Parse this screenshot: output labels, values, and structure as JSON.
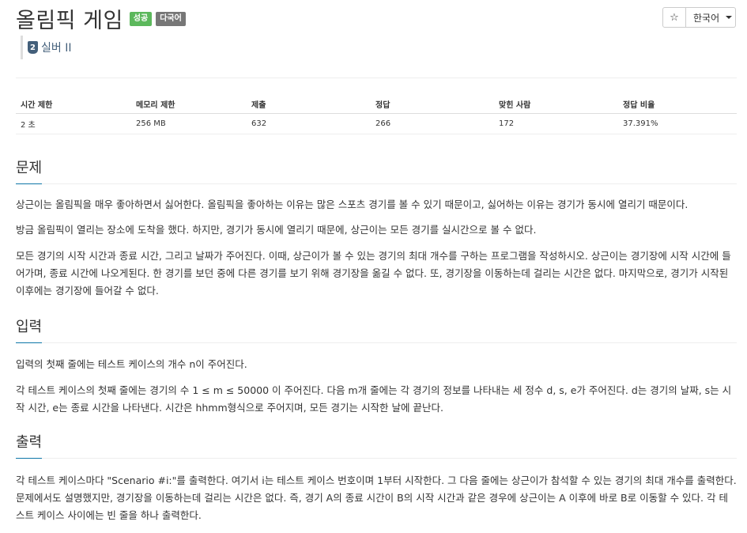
{
  "problem": {
    "title": "올림픽 게임",
    "labels": {
      "status": "성공",
      "lang": "다국어"
    },
    "tier": {
      "badge": "2",
      "text": "실버 II"
    }
  },
  "toolbar": {
    "star": "☆",
    "language": "한국어"
  },
  "info_table": {
    "headers": [
      "시간 제한",
      "메모리 제한",
      "제출",
      "정답",
      "맞힌 사람",
      "정답 비율"
    ],
    "values": [
      "2 초",
      "256 MB",
      "632",
      "266",
      "172",
      "37.391%"
    ]
  },
  "sections": {
    "description": {
      "title": "문제",
      "paragraphs": [
        "상근이는 올림픽을 매우 좋아하면서 싫어한다. 올림픽을 좋아하는 이유는 많은 스포츠 경기를 볼 수 있기 때문이고, 싫어하는 이유는 경기가 동시에 열리기 때문이다.",
        "방금 올림픽이 열리는 장소에 도착을 했다. 하지만, 경기가 동시에 열리기 때문에, 상근이는 모든 경기를 실시간으로 볼 수 없다.",
        "모든 경기의 시작 시간과 종료 시간, 그리고 날짜가 주어진다. 이때, 상근이가 볼 수 있는 경기의 최대 개수를 구하는 프로그램을 작성하시오. 상근이는 경기장에 시작 시간에 들어가며, 종료 시간에 나오게된다. 한 경기를 보던 중에 다른 경기를 보기 위해 경기장을 옮길 수 없다. 또, 경기장을 이동하는데 걸리는 시간은 없다. 마지막으로, 경기가 시작된 이후에는 경기장에 들어갈 수 없다."
      ]
    },
    "input": {
      "title": "입력",
      "paragraphs": [
        "입력의 첫째 줄에는 테스트 케이스의 개수 n이 주어진다.",
        "각 테스트 케이스의 첫째 줄에는 경기의 수  1 ≤ m ≤ 50000 이 주어진다. 다음 m개 줄에는 각 경기의 정보를 나타내는 세 정수 d, s, e가 주어진다. d는 경기의 날짜, s는 시작 시간, e는 종료 시간을 나타낸다. 시간은 hhmm형식으로 주어지며, 모든 경기는 시작한 날에 끝난다."
      ]
    },
    "output": {
      "title": "출력",
      "paragraphs": [
        "각 테스트 케이스마다 \"Scenario #i:\"를 출력한다. 여기서 i는 테스트 케이스 번호이며 1부터 시작한다. 그 다음 줄에는 상근이가 참석할 수 있는 경기의 최대 개수를 출력한다. 문제에서도 설명했지만, 경기장을 이동하는데 걸리는 시간은 없다. 즉, 경기 A의 종료 시간이 B의 시작 시간과 같은 경우에 상근이는 A 이후에 바로 B로 이동할 수 있다. 각 테스트 케이스 사이에는 빈 줄을 하나 출력한다."
      ]
    }
  },
  "colors": {
    "success": "#5cb85c",
    "lang_label": "#777777",
    "tier": "#435f7a",
    "section_underline": "#0e76a8"
  }
}
